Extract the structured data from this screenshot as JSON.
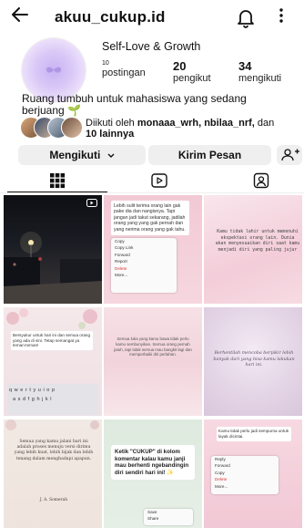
{
  "header": {
    "back_icon": "arrow-left-icon",
    "username": "akuu_cukup.id",
    "bell_icon": "bell-icon",
    "more_icon": "kebab-menu-icon"
  },
  "profile": {
    "name": "Self-Love & Growth",
    "stats": [
      {
        "value": "10",
        "label": "postingan"
      },
      {
        "value": "20",
        "label": "pengikut"
      },
      {
        "value": "34",
        "label": "mengikuti"
      }
    ],
    "bio_line1": "Ruang tumbuh untuk mahasiswa yang sedang",
    "bio_line2": "berjuang 🌱",
    "followed_by_prefix": "Diikuti oleh ",
    "followed_by_names": "monaaa_wrh, nbilaa_nrf,",
    "followed_by_mid": " dan",
    "followed_by_more": "10 lainnya"
  },
  "actions": {
    "following_label": "Mengikuti",
    "message_label": "Kirim Pesan",
    "add_user_icon": "add-person-icon"
  },
  "tabs": [
    {
      "icon": "grid-icon",
      "active": true
    },
    {
      "icon": "reels-play-icon",
      "active": false
    },
    {
      "icon": "tagged-person-icon",
      "active": false
    }
  ],
  "posts": {
    "p2_text": "Lebih sulit terima orang lain gak pake dia dan nangisnya. Tapi jangan jadi takut sekarang, jadilah orang yang yang gak pernah dan yang nerima orang yang gak tahu.",
    "p2_menu": [
      "Copy",
      "Copy Link",
      "Forward",
      "Report",
      "Delete",
      "More..."
    ],
    "p3_text": "Kamu tidak lahir untuk memenuhi ekspektasi orang lain. Dunia akan menyesuaikan diri saat kamu menjadi diri yang paling jujur",
    "p4_text": "Bersyukur untuk hari ini dan semua orang yang ada di sini. Tetap semangat ya teman-teman!",
    "p4_keys_row1": "qwertyuiop",
    "p4_keys_row2": "asdfghjkl",
    "p5_text": "Semua luka yang kamu bawa tidak perlu kamu sembunyikan. Semua orang pernah jatuh, tapi tidak semua mau bangkit lagi dan memperbaiki diri perlahan.",
    "p6_text": "Berhentilah mencoba berpikir lebih banyak dari yang bisa kamu lakukan hari ini.",
    "p7_text": "Semua yang kamu jalani hari ini adalah proses menuju versi dirimu yang lebih kuat, lebih bijak dan lebih tenang dalam menghadapi apapun.",
    "p7_author": "J. A. Somerah",
    "p8_text": "Ketik \"CUKUP\" di kolom komentar kalau kamu janji mau berhenti ngebandingin diri sendiri hari ini! ✨",
    "p8_menu": [
      "Save",
      "Share"
    ],
    "p9_text": "Kamu tidak perlu jadi sempurna untuk layak dicintai.",
    "p9_menu": [
      "Reply",
      "Forward",
      "Copy",
      "Delete",
      "More..."
    ]
  },
  "colors": {
    "text": "#111111",
    "button_bg": "#efefef",
    "delete_red": "#d33333",
    "avatar_lavender": "#c9b3f3"
  }
}
